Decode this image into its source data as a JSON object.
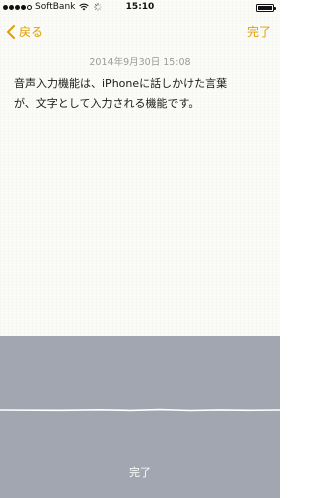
{
  "status_bar": {
    "carrier": "SoftBank",
    "time": "15:10",
    "signal_bars_filled": 4,
    "signal_bars_total": 5,
    "battery_level": 1.0
  },
  "nav": {
    "back_label": "戻る",
    "done_label": "完了"
  },
  "note": {
    "date": "2014年9月30日 15:08",
    "lines": [
      "音声入力機能は、iPhoneに話しかけた言葉",
      "が、文字として入力される機能です。"
    ]
  },
  "dictation": {
    "done_label": "完了"
  },
  "colors": {
    "accent": "#e0a000",
    "dictation_bg": "#a1a6b0",
    "paper_bg": "#fbfbf8"
  }
}
